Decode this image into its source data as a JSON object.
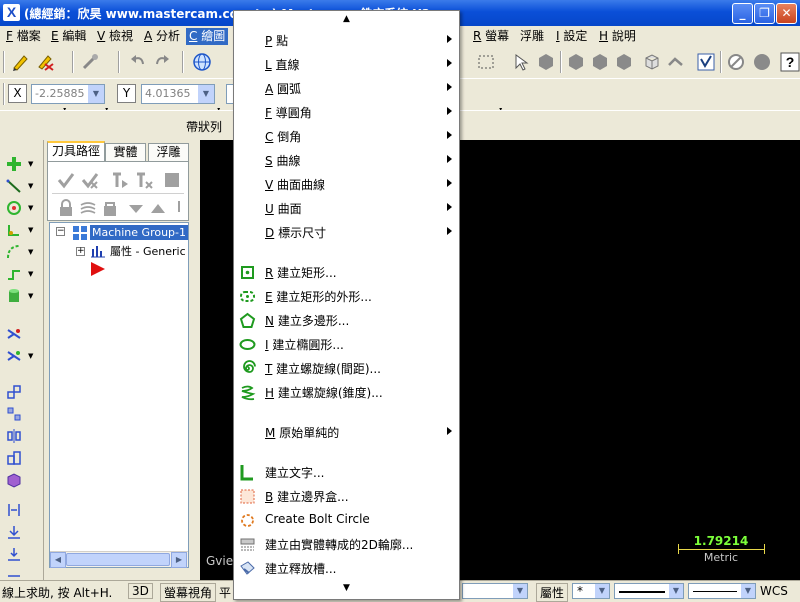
{
  "window": {
    "title": "(總經銷：欣昊 www.mastercam.com.tw) Mastercam 銑床系統 X2",
    "app_icon": "X",
    "min_label": "_",
    "max_label": "❐",
    "close_label": "✕"
  },
  "menubar": [
    {
      "key": "F",
      "label": "檔案"
    },
    {
      "key": "E",
      "label": "編輯"
    },
    {
      "key": "V",
      "label": "檢視"
    },
    {
      "key": "A",
      "label": "分析"
    },
    {
      "key": "C",
      "label": "繪圖"
    },
    {
      "key": "R",
      "label": "螢幕"
    },
    {
      "key": "",
      "label": "浮雕"
    },
    {
      "key": "I",
      "label": "設定"
    },
    {
      "key": "H",
      "label": "說明"
    }
  ],
  "coords": {
    "x_label": "X",
    "x_value": "-2.25885",
    "y_label": "Y",
    "y_value": "4.01365"
  },
  "ribbon_label": "帶狀列",
  "panel": {
    "tabs": [
      "刀具路徑",
      "實體",
      "浮雕"
    ],
    "tree_root": "Machine Group-1",
    "tree_child": "屬性 - Generic"
  },
  "viewport": {
    "gview": "Gview",
    "scale_value": "1.79214",
    "scale_unit": "Metric"
  },
  "status": {
    "help": "線上求助, 按 Alt+H.",
    "mode_3d": "3D",
    "screen_view": "螢幕視角",
    "plane": "平",
    "attr": "屬性",
    "wcs": "WCS"
  },
  "menu": {
    "submenu_items": [
      {
        "key": "P",
        "label": "點",
        "icon": "none"
      },
      {
        "key": "L",
        "label": "直線",
        "icon": "none"
      },
      {
        "key": "A",
        "label": "圓弧",
        "icon": "none"
      },
      {
        "key": "F",
        "label": "導圓角",
        "icon": "none"
      },
      {
        "key": "C",
        "label": "倒角",
        "icon": "none"
      },
      {
        "key": "S",
        "label": "曲線",
        "icon": "none"
      },
      {
        "key": "V",
        "label": "曲面曲線",
        "icon": "none"
      },
      {
        "key": "U",
        "label": "曲面",
        "icon": "none"
      },
      {
        "key": "D",
        "label": "標示尺寸",
        "icon": "none"
      }
    ],
    "shape_items": [
      {
        "key": "R",
        "label": "建立矩形...",
        "icon": "rectangle-icon"
      },
      {
        "key": "E",
        "label": "建立矩形的外形...",
        "icon": "rectangular-shape-icon"
      },
      {
        "key": "N",
        "label": "建立多邊形...",
        "icon": "polygon-icon"
      },
      {
        "key": "I",
        "label": "建立橢圓形...",
        "icon": "ellipse-icon"
      },
      {
        "key": "T",
        "label": "建立螺旋線(間距)...",
        "icon": "helix-pitch-icon"
      },
      {
        "key": "H",
        "label": "建立螺旋線(錐度)...",
        "icon": "helix-taper-icon"
      }
    ],
    "primitive_item": {
      "key": "M",
      "label": "原始單純的"
    },
    "misc_items": [
      {
        "key": "",
        "label": "建立文字...",
        "icon": "text-icon"
      },
      {
        "key": "B",
        "label": "建立邊界盒...",
        "icon": "bounding-box-icon"
      },
      {
        "key": "",
        "label": "Create Bolt Circle",
        "icon": "bolt-circle-icon"
      },
      {
        "key": "",
        "label": "建立由實體轉成的2D輪廓...",
        "icon": "solid-profile-icon"
      },
      {
        "key": "",
        "label": "建立釋放槽...",
        "icon": "undercut-icon"
      }
    ]
  },
  "colors": {
    "titlebar": "#0a4fd8",
    "menu_highlight": "#316ac5",
    "viewport_bg": "#000000",
    "scale_color": "#7cff3a",
    "tree_selected": "#316ac5"
  }
}
